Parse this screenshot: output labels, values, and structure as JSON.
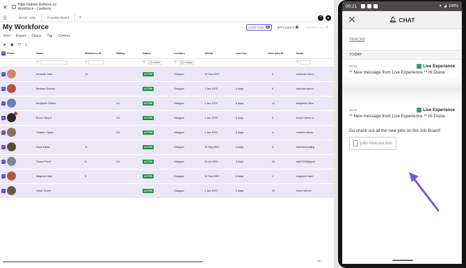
{
  "browser": {
    "url": "https://admin.liveforce.co",
    "page_title": "Workforce - Liveforce",
    "tabs": [
      "All Hol. Jobs",
      "Frontline Board"
    ]
  },
  "app": {
    "title": "My Workforce",
    "menus": [
      "View",
      "Export",
      "Status",
      "Tag",
      "Comms"
    ],
    "filters": [
      {
        "label": "EVERYONE",
        "count": "28"
      },
      {
        "label": "APPLICANTS",
        "count": "1"
      },
      {
        "label": "WAITING LIST",
        "count": "1"
      }
    ]
  },
  "table": {
    "columns": [
      "Photo",
      "Name",
      "Workforce ID",
      "Rating",
      "Status",
      "Location",
      "Joined",
      "Last Job",
      "Jobs (last M...",
      "Email"
    ],
    "filter_status": "(1) Active",
    "filter_location": "(1) Glasgo",
    "rows": [
      {
        "name": "Amanda Jean",
        "wid": "14",
        "rating": "",
        "status": "ACTIVE",
        "location": "Glasgow",
        "joined": "16 Sep 2022",
        "last": "",
        "jobs": "0",
        "email": "amanda+demo"
      },
      {
        "name": "Barbara Gordon",
        "wid": "",
        "rating": "",
        "status": "ACTIVE",
        "location": "Glasgow",
        "joined": "1 Jun 1970",
        "last": "4 days",
        "jobs": "6",
        "email": "barbara+demo"
      },
      {
        "name": "Benjamin Grimm",
        "wid": "",
        "rating": "4.0",
        "status": "ACTIVE",
        "location": "Glasgow",
        "joined": "1 Jun 1970",
        "last": "6 days",
        "jobs": "11",
        "email": "benjamin+dem"
      },
      {
        "name": "Bruce Wayne",
        "wid": "",
        "rating": "4.6",
        "status": "ACTIVE",
        "location": "Glasgow",
        "joined": "1 Jun 1970",
        "last": "6 days",
        "jobs": "9",
        "email": "bruce+demo+o"
      },
      {
        "name": "Charles Xavier",
        "wid": "",
        "rating": "2.5",
        "status": "ACTIVE",
        "location": "Glasgow",
        "joined": "1 Jun 1970",
        "last": "6 days",
        "jobs": "4",
        "email": "charles+demo"
      },
      {
        "name": "Dave Demo",
        "wid": "11",
        "rating": "",
        "status": "ACTIVE",
        "location": "Glasgow",
        "joined": "10 Sep 2022",
        "last": "4 days",
        "jobs": "4",
        "email": "davedemo4@g"
      },
      {
        "name": "Diana Prince",
        "wid": "6",
        "rating": "3.0",
        "status": "ACTIVE",
        "location": "Glasgow",
        "joined": "22 Jul 2022",
        "last": "4 days",
        "jobs": "20",
        "email": "dpi07035@gma"
      },
      {
        "name": "Magneto Max",
        "wid": "9",
        "rating": "",
        "status": "ACTIVE",
        "location": "Glasgow",
        "joined": "10 Sep 2022",
        "last": "6 days",
        "jobs": "1",
        "email": "magneto+dem"
      },
      {
        "name": "Victor Creed",
        "wid": "",
        "rating": "",
        "status": "ACTIVE",
        "location": "Glasgow",
        "joined": "1 Jun 1970",
        "last": "2 days",
        "jobs": "20",
        "email": "victor+demo+"
      }
    ]
  },
  "phone": {
    "time": "00:21",
    "battery": "100%",
    "header_title": "CHAT",
    "view_job": "View job",
    "day_label": "TODAY",
    "messages": [
      {
        "time": "00:18",
        "sender": "Live Experience",
        "text": "** New message from Live Experience ** Hi Diana"
      },
      {
        "time": "00:20",
        "sender": "Live Experience",
        "text": "** New message from Live Experience ** Hi Diana",
        "extra": "Go check out all the new jobs on the Job Board!",
        "attachment": "jobs-forecast.doc"
      }
    ]
  },
  "colors": {
    "accent": "#5b43cc",
    "active": "#1b8f3a",
    "row_bg": "#ebe7f7",
    "arrow": "#7b57e0"
  }
}
